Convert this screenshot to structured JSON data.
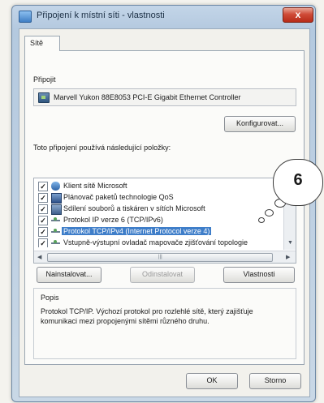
{
  "window": {
    "title": "Připojení k místní síti - vlastnosti",
    "close_glyph": "x"
  },
  "tabs": [
    {
      "label": "Sítě"
    }
  ],
  "connect": {
    "label": "Připojit",
    "adapter_name": "Marvell Yukon 88E8053 PCI-E Gigabit Ethernet Controller",
    "configure_button": "Konfigurovat..."
  },
  "items_label": "Toto připojení používá následující položky:",
  "items": [
    {
      "label": "Klient sítě Microsoft",
      "checked": true,
      "icon": "network-client-icon"
    },
    {
      "label": "Plánovač paketů technologie QoS",
      "checked": true,
      "icon": "packet-scheduler-icon"
    },
    {
      "label": "Sdílení souborů a tiskáren v sítích Microsoft",
      "checked": true,
      "icon": "file-sharing-icon"
    },
    {
      "label": "Protokol IP verze 6 (TCP/IPv6)",
      "checked": true,
      "icon": "protocol-icon"
    },
    {
      "label": "Protokol TCP/IPv4 (Internet Protocol verze 4)",
      "checked": true,
      "icon": "protocol-icon",
      "selected": true
    },
    {
      "label": "Vstupně-výstupní ovladač mapovače zjišťování topologie",
      "checked": true,
      "icon": "protocol-icon"
    }
  ],
  "check_glyph": "✓",
  "buttons": {
    "install": "Nainstalovat...",
    "uninstall": "Odinstalovat",
    "properties": "Vlastnosti",
    "ok": "OK",
    "cancel": "Storno"
  },
  "description": {
    "label": "Popis",
    "text": "Protokol TCP/IP. Výchozí protokol pro rozlehlé sítě, který zajišťuje komunikaci mezi propojenými sítěmi různého druhu."
  },
  "callout": {
    "number": "6"
  },
  "scrollbar": {
    "grip": "|||"
  },
  "colors": {
    "selection": "#3f7ec9",
    "close_button": "#c73a25"
  }
}
